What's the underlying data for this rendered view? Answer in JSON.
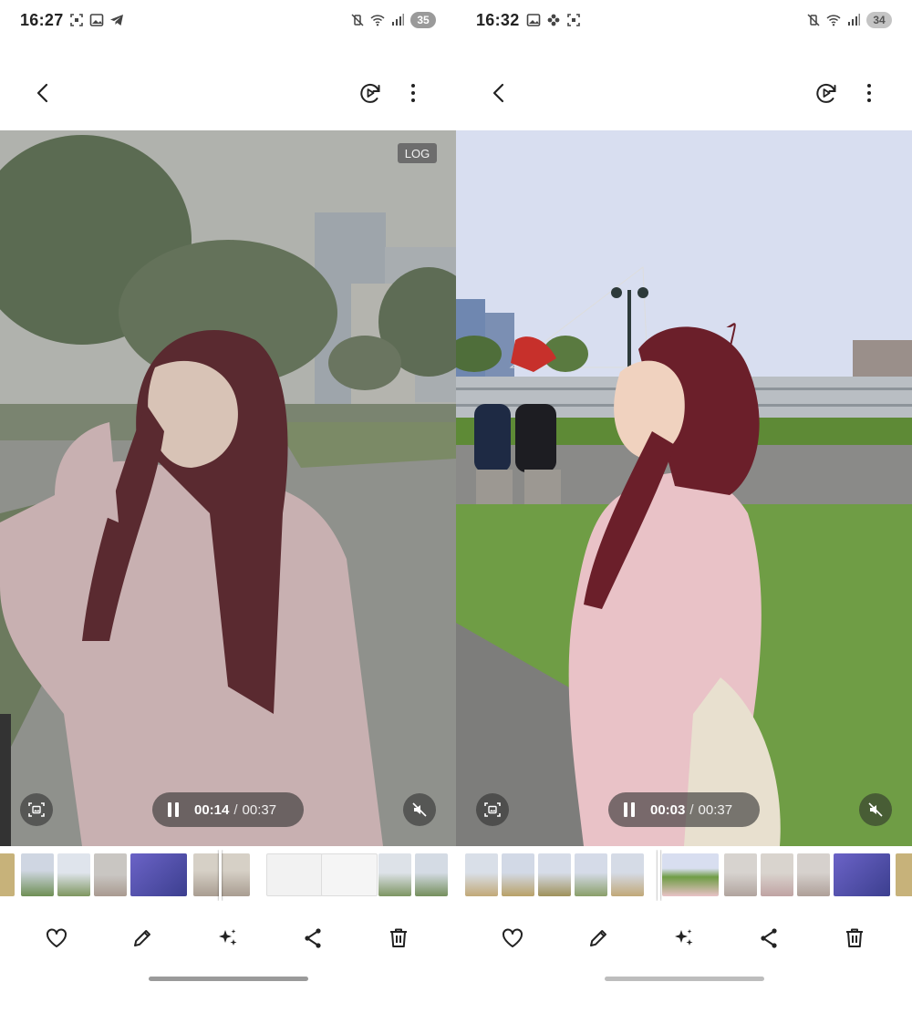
{
  "screens": [
    {
      "id": "left",
      "status_bar": {
        "time": "16:27",
        "battery": "35"
      },
      "badge": "LOG",
      "player": {
        "current_time": "00:14",
        "separator": "/",
        "total_time": "00:37"
      },
      "icons": {
        "back": "back-arrow-icon",
        "motion": "motion-photo-icon",
        "more": "more-vertical-icon",
        "capture": "capture-frame-icon",
        "mute": "mute-icon"
      },
      "actions": [
        "heart-icon",
        "edit-pencil-icon",
        "sparkle-icon",
        "share-icon",
        "delete-icon"
      ]
    },
    {
      "id": "right",
      "status_bar": {
        "time": "16:32",
        "battery": "34"
      },
      "player": {
        "current_time": "00:03",
        "separator": "/",
        "total_time": "00:37"
      },
      "icons": {
        "back": "back-arrow-icon",
        "motion": "motion-photo-icon",
        "more": "more-vertical-icon",
        "capture": "capture-frame-icon",
        "mute": "mute-icon"
      },
      "actions": [
        "heart-icon",
        "edit-pencil-icon",
        "sparkle-icon",
        "share-icon",
        "delete-icon"
      ]
    }
  ],
  "colors": {
    "left_tint": "#8f928c",
    "right_sky": "#d9dff0",
    "grass": "#6f9d45",
    "sweater": "#e8c3c8",
    "hair": "#6b1f2a"
  }
}
